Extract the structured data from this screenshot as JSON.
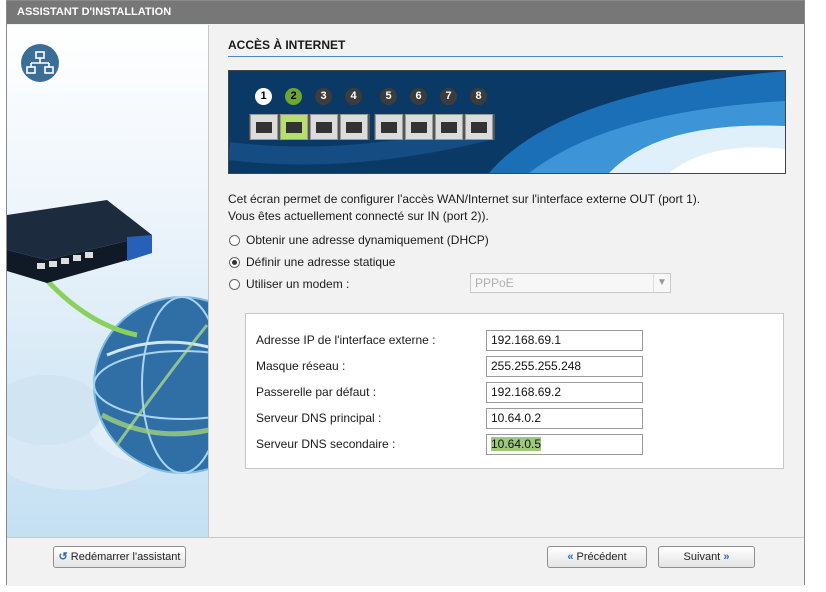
{
  "window": {
    "title": "ASSISTANT D'INSTALLATION"
  },
  "section": {
    "title": "ACCÈS À INTERNET"
  },
  "ports": {
    "numbers": [
      "1",
      "2",
      "3",
      "4",
      "5",
      "6",
      "7",
      "8"
    ],
    "out_port": "1",
    "in_port": "2"
  },
  "description": {
    "line1": "Cet écran permet de configurer l'accès WAN/Internet sur l'interface externe OUT (port 1).",
    "line2": "Vous êtes actuellement connecté sur IN (port 2))."
  },
  "options": {
    "dhcp": {
      "label": "Obtenir une adresse dynamiquement (DHCP)",
      "checked": false
    },
    "static": {
      "label": "Définir une adresse statique",
      "checked": true
    },
    "modem": {
      "label": "Utiliser un modem :",
      "checked": false
    }
  },
  "modem_select": {
    "value": "PPPoE"
  },
  "fields": [
    {
      "label": "Adresse IP de l'interface externe :",
      "value": "192.168.69.1"
    },
    {
      "label": "Masque réseau :",
      "value": "255.255.255.248"
    },
    {
      "label": "Passerelle par défaut :",
      "value": "192.168.69.2"
    },
    {
      "label": "Serveur DNS principal :",
      "value": "10.64.0.2"
    },
    {
      "label": "Serveur DNS secondaire :",
      "value": "10.64.0.5"
    }
  ],
  "buttons": {
    "restart": "Redémarrer l'assistant",
    "previous": "Précédent",
    "next": "Suivant"
  },
  "icons": {
    "sidebar": "network-icon",
    "restart": "restart-icon",
    "previous": "double-left-arrow-icon",
    "next": "double-right-arrow-icon"
  },
  "colors": {
    "accent": "#4a86c8",
    "titlebar": "#777777",
    "in_port": "#6aa833"
  }
}
